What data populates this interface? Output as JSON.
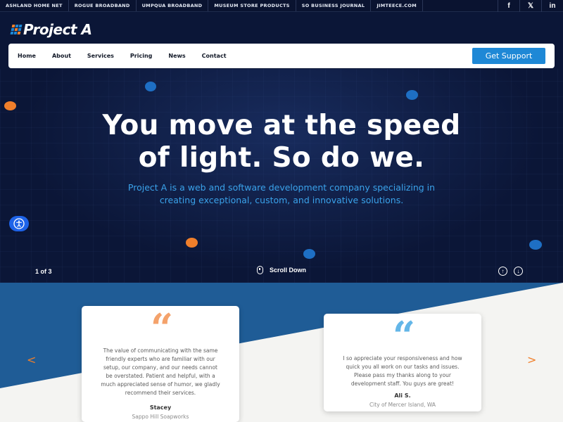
{
  "topbar": {
    "links": [
      "ASHLAND HOME NET",
      "ROGUE BROADBAND",
      "UMPQUA BROADBAND",
      "MUSEUM STORE PRODUCTS",
      "SO BUSINESS JOURNAL",
      "JIMTEECE.COM"
    ],
    "social": [
      "f",
      "𝕏",
      "in"
    ]
  },
  "logo": {
    "text": "Project A"
  },
  "nav": {
    "items": [
      "Home",
      "About",
      "Services",
      "Pricing",
      "News",
      "Contact"
    ],
    "cta": "Get Support"
  },
  "hero": {
    "title_line1": "You move at the speed",
    "title_line2": "of light. So do we.",
    "subtitle_line1": "Project A is a web and software development company specializing in",
    "subtitle_line2": "creating exceptional, custom, and innovative solutions.",
    "slide_counter": "1 of 3",
    "scroll_label": "Scroll Down"
  },
  "testimonials": [
    {
      "quote": "The value of communicating with the same friendly experts who are familiar with our setup, our company, and our needs cannot be overstated. Patient and helpful, with a much appreciated sense of humor, we gladly recommend their services.",
      "name": "Stacey",
      "org": "Sappo Hill Soapworks",
      "mark_color": "#f4a26b"
    },
    {
      "quote": "I so appreciate your responsiveness and how quick you all work on our tasks and issues. Please pass my thanks along to your development staff. You guys are great!",
      "name": "Ali S.",
      "org": "City of Mercer Island, WA",
      "mark_color": "#63b6e8"
    }
  ],
  "colors": {
    "brand_dark": "#0b1637",
    "accent_blue": "#1e88d6",
    "accent_orange": "#f07f2b",
    "band_blue": "#1f5c96"
  }
}
